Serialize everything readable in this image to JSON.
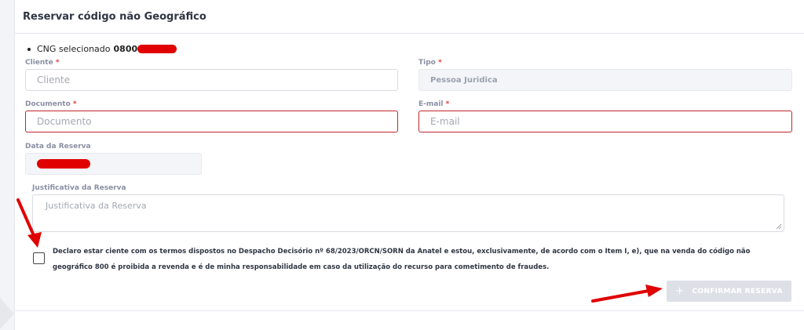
{
  "header": {
    "title": "Reservar código não Geográfico"
  },
  "cng": {
    "label": "CNG selecionado",
    "number_prefix": "0800"
  },
  "fields": {
    "cliente": {
      "label": "Cliente",
      "required_mark": "*",
      "placeholder": "Cliente"
    },
    "tipo": {
      "label": "Tipo",
      "required_mark": "*",
      "value": "Pessoa Juridica"
    },
    "documento": {
      "label": "Documento",
      "required_mark": "*",
      "placeholder": "Documento"
    },
    "email": {
      "label": "E-mail",
      "required_mark": "*",
      "placeholder": "E-mail"
    },
    "data_reserva": {
      "label": "Data da Reserva"
    },
    "justificativa": {
      "label": "Justificativa da Reserva",
      "placeholder": "Justificativa da Reserva"
    }
  },
  "declaration": {
    "line1": "Declaro estar ciente com os termos dispostos no Despacho Decisório nº 68/2023/ORCN/SORN da Anatel e estou, exclusivamente, de acordo com o Item I, e), que na venda do código não",
    "line2": "geográfico 800 é proibida a revenda e é de minha responsabilidade em caso da utilização do recurso para cometimento de fraudes."
  },
  "actions": {
    "confirm_icon": "+",
    "confirm_label": "CONFIRMAR RESERVA"
  },
  "colors": {
    "error_border": "#c0262b",
    "required": "#e53935",
    "annotation_red": "#e00000",
    "disabled_button": "#dde0e6"
  }
}
